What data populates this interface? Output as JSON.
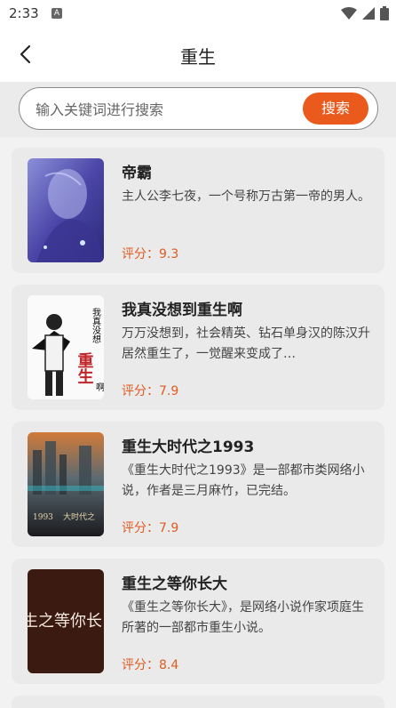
{
  "status_bar": {
    "time": "2:33",
    "a_label": "A"
  },
  "header": {
    "title": "重生"
  },
  "search": {
    "placeholder": "输入关键词进行搜索",
    "button_label": "搜索"
  },
  "books": [
    {
      "title": "帝霸",
      "desc": "主人公李七夜，一个号称万古第一帝的男人。",
      "score": "评分：9.3"
    },
    {
      "title": "我真没想到重生啊",
      "desc": "万万没想到，社会精英、钻石单身汉的陈汉升居然重生了，一觉醒来变成了…",
      "score": "评分：7.9",
      "cover_text": {
        "vertical": "我真没想",
        "main": "重生",
        "side": "啊"
      }
    },
    {
      "title": "重生大时代之1993",
      "desc": "《重生大时代之1993》是一部都市类网络小说，作者是三月麻竹，已完结。",
      "score": "评分：7.9",
      "cover_text": {
        "year": "1993",
        "sub": "大时代之"
      }
    },
    {
      "title": "重生之等你长大",
      "desc": "《重生之等你长大》，是网络小说作家项庭生所著的一部都市重生小说。",
      "score": "评分：8.4",
      "cover_text": {
        "main": "生之等你长"
      }
    }
  ],
  "colors": {
    "accent": "#ea5a1c",
    "score": "#e05b22"
  }
}
